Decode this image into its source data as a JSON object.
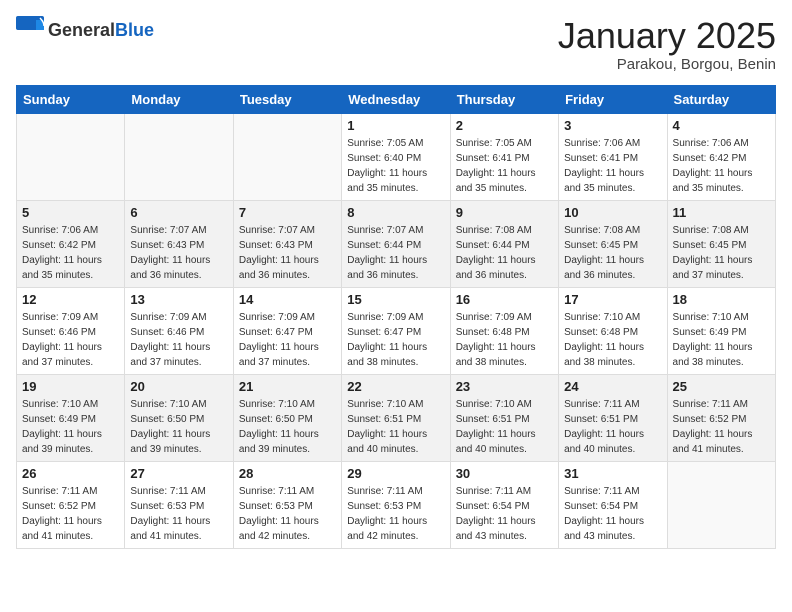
{
  "header": {
    "logo_general": "General",
    "logo_blue": "Blue",
    "title": "January 2025",
    "location": "Parakou, Borgou, Benin"
  },
  "weekdays": [
    "Sunday",
    "Monday",
    "Tuesday",
    "Wednesday",
    "Thursday",
    "Friday",
    "Saturday"
  ],
  "weeks": [
    {
      "shaded": false,
      "days": [
        {
          "num": "",
          "info": ""
        },
        {
          "num": "",
          "info": ""
        },
        {
          "num": "",
          "info": ""
        },
        {
          "num": "1",
          "info": "Sunrise: 7:05 AM\nSunset: 6:40 PM\nDaylight: 11 hours and 35 minutes."
        },
        {
          "num": "2",
          "info": "Sunrise: 7:05 AM\nSunset: 6:41 PM\nDaylight: 11 hours and 35 minutes."
        },
        {
          "num": "3",
          "info": "Sunrise: 7:06 AM\nSunset: 6:41 PM\nDaylight: 11 hours and 35 minutes."
        },
        {
          "num": "4",
          "info": "Sunrise: 7:06 AM\nSunset: 6:42 PM\nDaylight: 11 hours and 35 minutes."
        }
      ]
    },
    {
      "shaded": true,
      "days": [
        {
          "num": "5",
          "info": "Sunrise: 7:06 AM\nSunset: 6:42 PM\nDaylight: 11 hours and 35 minutes."
        },
        {
          "num": "6",
          "info": "Sunrise: 7:07 AM\nSunset: 6:43 PM\nDaylight: 11 hours and 36 minutes."
        },
        {
          "num": "7",
          "info": "Sunrise: 7:07 AM\nSunset: 6:43 PM\nDaylight: 11 hours and 36 minutes."
        },
        {
          "num": "8",
          "info": "Sunrise: 7:07 AM\nSunset: 6:44 PM\nDaylight: 11 hours and 36 minutes."
        },
        {
          "num": "9",
          "info": "Sunrise: 7:08 AM\nSunset: 6:44 PM\nDaylight: 11 hours and 36 minutes."
        },
        {
          "num": "10",
          "info": "Sunrise: 7:08 AM\nSunset: 6:45 PM\nDaylight: 11 hours and 36 minutes."
        },
        {
          "num": "11",
          "info": "Sunrise: 7:08 AM\nSunset: 6:45 PM\nDaylight: 11 hours and 37 minutes."
        }
      ]
    },
    {
      "shaded": false,
      "days": [
        {
          "num": "12",
          "info": "Sunrise: 7:09 AM\nSunset: 6:46 PM\nDaylight: 11 hours and 37 minutes."
        },
        {
          "num": "13",
          "info": "Sunrise: 7:09 AM\nSunset: 6:46 PM\nDaylight: 11 hours and 37 minutes."
        },
        {
          "num": "14",
          "info": "Sunrise: 7:09 AM\nSunset: 6:47 PM\nDaylight: 11 hours and 37 minutes."
        },
        {
          "num": "15",
          "info": "Sunrise: 7:09 AM\nSunset: 6:47 PM\nDaylight: 11 hours and 38 minutes."
        },
        {
          "num": "16",
          "info": "Sunrise: 7:09 AM\nSunset: 6:48 PM\nDaylight: 11 hours and 38 minutes."
        },
        {
          "num": "17",
          "info": "Sunrise: 7:10 AM\nSunset: 6:48 PM\nDaylight: 11 hours and 38 minutes."
        },
        {
          "num": "18",
          "info": "Sunrise: 7:10 AM\nSunset: 6:49 PM\nDaylight: 11 hours and 38 minutes."
        }
      ]
    },
    {
      "shaded": true,
      "days": [
        {
          "num": "19",
          "info": "Sunrise: 7:10 AM\nSunset: 6:49 PM\nDaylight: 11 hours and 39 minutes."
        },
        {
          "num": "20",
          "info": "Sunrise: 7:10 AM\nSunset: 6:50 PM\nDaylight: 11 hours and 39 minutes."
        },
        {
          "num": "21",
          "info": "Sunrise: 7:10 AM\nSunset: 6:50 PM\nDaylight: 11 hours and 39 minutes."
        },
        {
          "num": "22",
          "info": "Sunrise: 7:10 AM\nSunset: 6:51 PM\nDaylight: 11 hours and 40 minutes."
        },
        {
          "num": "23",
          "info": "Sunrise: 7:10 AM\nSunset: 6:51 PM\nDaylight: 11 hours and 40 minutes."
        },
        {
          "num": "24",
          "info": "Sunrise: 7:11 AM\nSunset: 6:51 PM\nDaylight: 11 hours and 40 minutes."
        },
        {
          "num": "25",
          "info": "Sunrise: 7:11 AM\nSunset: 6:52 PM\nDaylight: 11 hours and 41 minutes."
        }
      ]
    },
    {
      "shaded": false,
      "days": [
        {
          "num": "26",
          "info": "Sunrise: 7:11 AM\nSunset: 6:52 PM\nDaylight: 11 hours and 41 minutes."
        },
        {
          "num": "27",
          "info": "Sunrise: 7:11 AM\nSunset: 6:53 PM\nDaylight: 11 hours and 41 minutes."
        },
        {
          "num": "28",
          "info": "Sunrise: 7:11 AM\nSunset: 6:53 PM\nDaylight: 11 hours and 42 minutes."
        },
        {
          "num": "29",
          "info": "Sunrise: 7:11 AM\nSunset: 6:53 PM\nDaylight: 11 hours and 42 minutes."
        },
        {
          "num": "30",
          "info": "Sunrise: 7:11 AM\nSunset: 6:54 PM\nDaylight: 11 hours and 43 minutes."
        },
        {
          "num": "31",
          "info": "Sunrise: 7:11 AM\nSunset: 6:54 PM\nDaylight: 11 hours and 43 minutes."
        },
        {
          "num": "",
          "info": ""
        }
      ]
    }
  ]
}
